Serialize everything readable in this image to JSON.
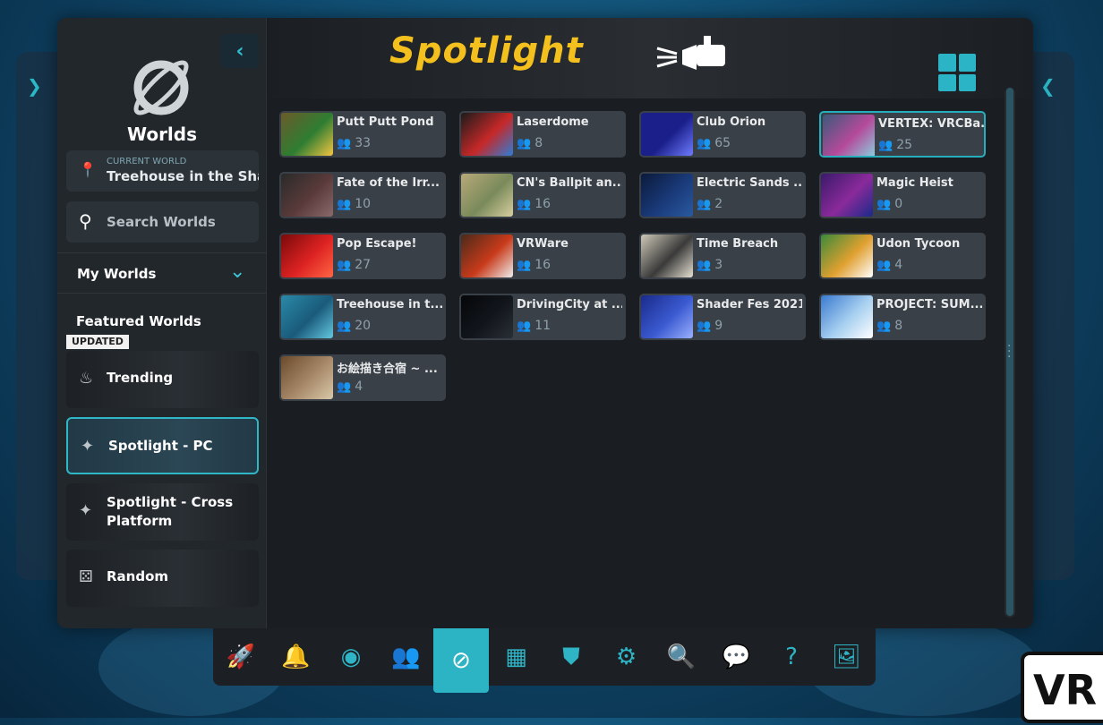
{
  "sidebar": {
    "back_icon": "chevron-left-icon",
    "title": "Worlds",
    "current_world": {
      "caption": "CURRENT WORLD",
      "value": "Treehouse in the Sha"
    },
    "search": {
      "label": "Search Worlds"
    },
    "my_worlds": "My Worlds",
    "featured": "Featured Worlds",
    "updated_badge": "UPDATED",
    "categories": [
      {
        "label": "Trending",
        "icon": "flame-icon"
      },
      {
        "label": "Spotlight - PC",
        "icon": "spotlight-icon",
        "active": true
      },
      {
        "label": "Spotlight - Cross Platform",
        "icon": "spotlight-icon"
      },
      {
        "label": "Random",
        "icon": "dice-icon"
      }
    ]
  },
  "header": {
    "title": "Spotlight"
  },
  "worlds": [
    {
      "name": "Putt Putt Pond",
      "count": "33",
      "colors": [
        "#6b5a2a",
        "#2e7d32",
        "#f4c542"
      ]
    },
    {
      "name": "Laserdome",
      "count": "8",
      "colors": [
        "#1b1b1b",
        "#c62828",
        "#2e7dd6"
      ]
    },
    {
      "name": "Club Orion",
      "count": "65",
      "colors": [
        "#1a1f8a",
        "#1a1f8a",
        "#6f7cff"
      ]
    },
    {
      "name": "VERTEX: VRCBa...",
      "count": "25",
      "colors": [
        "#3a5a7a",
        "#b54a9a",
        "#8ad0e0"
      ]
    },
    {
      "name": "Fate of the Irr...",
      "count": "10",
      "colors": [
        "#2a2a2a",
        "#5a3a3a",
        "#8a6a6a"
      ]
    },
    {
      "name": "CN's Ballpit an...",
      "count": "16",
      "colors": [
        "#b8a97a",
        "#7a8a5a",
        "#d8cfa0"
      ]
    },
    {
      "name": "Electric Sands ...",
      "count": "2",
      "colors": [
        "#0b1a3a",
        "#1a3a7a",
        "#2a5aa0"
      ]
    },
    {
      "name": "Magic Heist",
      "count": "0",
      "colors": [
        "#3a1a6a",
        "#8a2a9a",
        "#1a2a8a"
      ]
    },
    {
      "name": "Pop Escape!",
      "count": "27",
      "colors": [
        "#7a0a0a",
        "#d22",
        "#ff6644"
      ]
    },
    {
      "name": "VRWare",
      "count": "16",
      "colors": [
        "#4a2a1a",
        "#c83a1a",
        "#eeeeee"
      ]
    },
    {
      "name": "Time Breach",
      "count": "3",
      "colors": [
        "#cfc9b8",
        "#3a3a3a",
        "#e6e1d2"
      ]
    },
    {
      "name": "Udon Tycoon",
      "count": "4",
      "colors": [
        "#3a8a3a",
        "#e0a030",
        "#ffffff"
      ]
    },
    {
      "name": "Treehouse in t...",
      "count": "20",
      "colors": [
        "#2a8aa8",
        "#1a5a7a",
        "#64c8e0"
      ]
    },
    {
      "name": "DrivingCity at ...",
      "count": "11",
      "colors": [
        "#050608",
        "#12161c",
        "#2a2f36"
      ]
    },
    {
      "name": "Shader Fes 2021",
      "count": "9",
      "colors": [
        "#1a2a8a",
        "#3a5ad0",
        "#9ab0ff"
      ]
    },
    {
      "name": "PROJECT: SUM...",
      "count": "8",
      "colors": [
        "#3a7ad0",
        "#a8d0f0",
        "#ffffff"
      ]
    },
    {
      "name": "お絵描き合宿 ~ ...",
      "count": "4",
      "colors": [
        "#6a4a2a",
        "#a88a6a",
        "#d8c8a8"
      ]
    }
  ],
  "dock": [
    {
      "name": "rocket-icon",
      "glyph": "🚀"
    },
    {
      "name": "bell-icon",
      "glyph": "🔔"
    },
    {
      "name": "profile-icon",
      "glyph": "◉"
    },
    {
      "name": "social-icon",
      "glyph": "👥"
    },
    {
      "name": "worlds-icon",
      "glyph": "⊘",
      "active": true
    },
    {
      "name": "avatars-icon",
      "glyph": "▦"
    },
    {
      "name": "safety-shield-icon",
      "glyph": "⛊"
    },
    {
      "name": "settings-gear-icon",
      "glyph": "⚙"
    },
    {
      "name": "search-icon",
      "glyph": "🔍"
    },
    {
      "name": "chat-icon",
      "glyph": "💬"
    },
    {
      "name": "help-icon",
      "glyph": "?"
    },
    {
      "name": "gallery-icon",
      "glyph": "🖼"
    }
  ],
  "watermark": "VR"
}
